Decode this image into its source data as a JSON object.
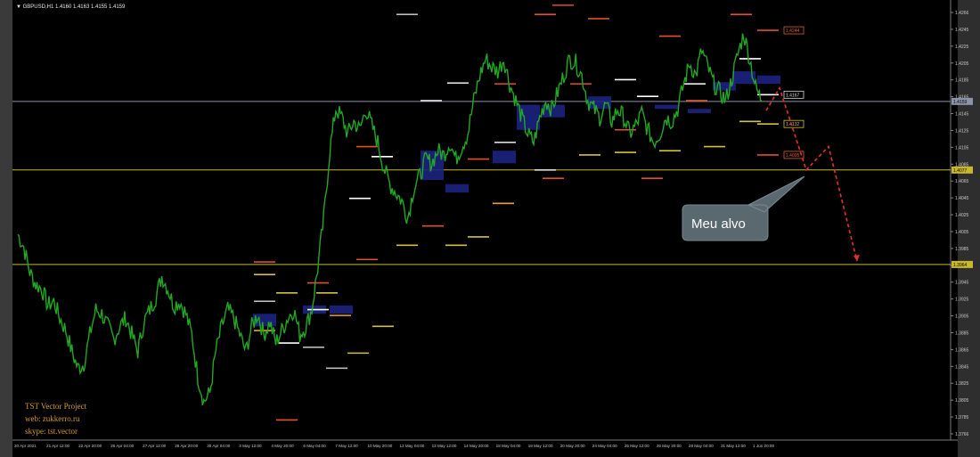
{
  "header": {
    "symbol_label": "GBPUSD,H1",
    "quote": "1.4160 1.4163 1.4155 1.4159"
  },
  "watermark": {
    "line1": "TST Vector Project",
    "line2": "web: zukkerro.ru",
    "line3": "skype: tst.vector"
  },
  "callout": {
    "text": "Meu alvo"
  },
  "chart_data": {
    "type": "line",
    "title": "",
    "price_range": [
      1.3754,
      1.4276
    ],
    "y_ticks": [
      "1.4266",
      "1.4245",
      "1.4225",
      "1.4205",
      "1.4185",
      "1.4165",
      "1.4145",
      "1.4125",
      "1.4105",
      "1.4085",
      "1.4065",
      "1.4045",
      "1.4025",
      "1.4005",
      "1.3985",
      "1.3965",
      "1.3945",
      "1.3925",
      "1.3905",
      "1.3885",
      "1.3865",
      "1.3845",
      "1.3825",
      "1.3805",
      "1.3785",
      "1.3766"
    ],
    "x_ticks": [
      "20 Apr 2021",
      "21 Apr 12:00",
      "22 Apr 20:00",
      "26 Apr 04:00",
      "27 Apr 12:00",
      "28 Apr 20:00",
      "30 Apr 04:00",
      "3 May 12:00",
      "4 May 20:00",
      "6 May 04:00",
      "7 May 12:00",
      "10 May 20:00",
      "12 May 04:00",
      "13 May 12:00",
      "14 May 20:00",
      "18 May 04:00",
      "19 May 12:00",
      "20 May 20:00",
      "24 May 04:00",
      "25 May 12:00",
      "26 May 20:00",
      "28 May 04:00",
      "31 May 12:00",
      "1 Jun 20:00"
    ],
    "series": [
      {
        "color": "#22a822",
        "values": [
          1.4,
          1.3985,
          1.3955,
          1.394,
          1.3935,
          1.3915,
          1.392,
          1.39,
          1.3885,
          1.386,
          1.384,
          1.3845,
          1.388,
          1.391,
          1.3905,
          1.389,
          1.3875,
          1.389,
          1.39,
          1.388,
          1.386,
          1.3895,
          1.391,
          1.3925,
          1.395,
          1.3935,
          1.3915,
          1.392,
          1.3905,
          1.388,
          1.383,
          1.38,
          1.381,
          1.386,
          1.389,
          1.391,
          1.39,
          1.388,
          1.386,
          1.389,
          1.3905,
          1.388,
          1.3895,
          1.387,
          1.3885,
          1.39,
          1.391,
          1.388,
          1.389,
          1.391,
          1.396,
          1.402,
          1.41,
          1.415,
          1.414,
          1.412,
          1.4135,
          1.4125,
          1.415,
          1.413,
          1.411,
          1.408,
          1.406,
          1.405,
          1.404,
          1.402,
          1.4055,
          1.407,
          1.409,
          1.4085,
          1.41,
          1.4095,
          1.411,
          1.409,
          1.4105,
          1.412,
          1.416,
          1.419,
          1.421,
          1.42,
          1.4195,
          1.421,
          1.418,
          1.416,
          1.414,
          1.412,
          1.411,
          1.414,
          1.416,
          1.415,
          1.417,
          1.419,
          1.421,
          1.4205,
          1.419,
          1.416,
          1.415,
          1.414,
          1.4155,
          1.4135,
          1.415,
          1.414,
          1.412,
          1.413,
          1.4145,
          1.4125,
          1.411,
          1.412,
          1.414,
          1.4135,
          1.415,
          1.418,
          1.4205,
          1.419,
          1.422,
          1.42,
          1.418,
          1.417,
          1.416,
          1.4185,
          1.4215,
          1.424,
          1.421,
          1.4175,
          1.416
        ]
      }
    ],
    "horizontal_lines": [
      {
        "price": 1.4159,
        "color": "#8a93a8",
        "label": "1.4159"
      },
      {
        "price": 1.4077,
        "color": "#c9b92a",
        "label": "1.4077"
      },
      {
        "price": 1.3964,
        "color": "#c9b92a",
        "label": "1.3964"
      }
    ],
    "price_tags": [
      {
        "price": 1.4244,
        "text": "1.4244",
        "color": "#e06030"
      },
      {
        "price": 1.4167,
        "text": "1.4167",
        "color": "#d8d8d8"
      },
      {
        "price": 1.4132,
        "text": "1.4132",
        "color": "#d4c040"
      },
      {
        "price": 1.4095,
        "text": "1.4095",
        "color": "#e06030"
      }
    ],
    "zones_color": "#1c2480",
    "projection_color": "#e53030"
  }
}
